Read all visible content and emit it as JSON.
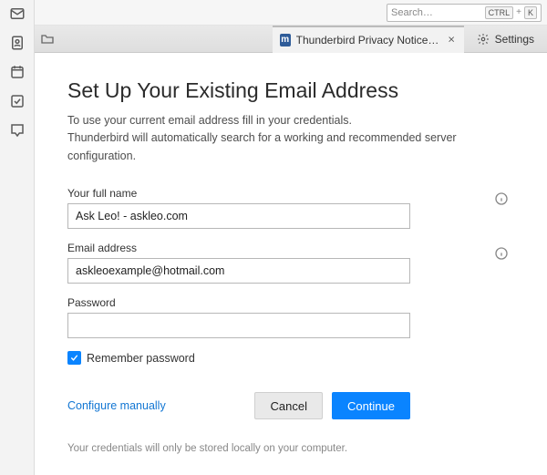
{
  "toolbar": {
    "search_placeholder": "Search…",
    "kbd1": "CTRL",
    "kbd2": "K"
  },
  "tabs": {
    "privacy": {
      "label": "Thunderbird Privacy Notice — Moz"
    },
    "settings": {
      "label": "Settings"
    }
  },
  "setup": {
    "heading": "Set Up Your Existing Email Address",
    "intro1": "To use your current email address fill in your credentials.",
    "intro2": "Thunderbird will automatically search for a working and recommended server configuration.",
    "fullname_label": "Your full name",
    "fullname_value": "Ask Leo! - askleo.com",
    "email_label": "Email address",
    "email_value": "askleoexample@hotmail.com",
    "password_label": "Password",
    "password_value": "",
    "remember_label": "Remember password",
    "configure_link": "Configure manually",
    "cancel": "Cancel",
    "continue": "Continue",
    "footer": "Your credentials will only be stored locally on your computer."
  },
  "icons": {
    "favicon_glyph": "m"
  }
}
